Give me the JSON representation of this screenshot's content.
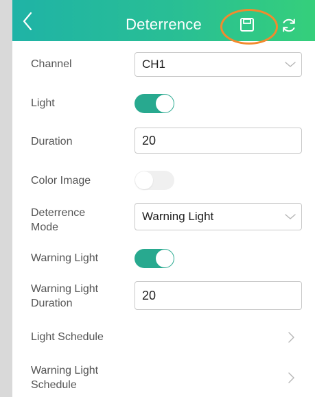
{
  "header": {
    "title": "Deterrence",
    "back_icon": "chevron-left-icon",
    "save_icon": "save-floppy-icon",
    "refresh_icon": "refresh-icon",
    "highlight_color": "#f28a2e",
    "gradient_colors": [
      "#1fb3a6",
      "#35cf7b"
    ]
  },
  "settings": {
    "channel": {
      "label": "Channel",
      "value": "CH1"
    },
    "light": {
      "label": "Light",
      "enabled": true
    },
    "duration": {
      "label": "Duration",
      "value": "20"
    },
    "color_image": {
      "label": "Color Image",
      "enabled": false
    },
    "deterrence_mode": {
      "label_line1": "Deterrence",
      "label_line2": "Mode",
      "value": "Warning Light"
    },
    "warning_light": {
      "label": "Warning Light",
      "enabled": true
    },
    "warning_light_duration": {
      "label_line1": "Warning Light",
      "label_line2": "Duration",
      "value": "20"
    },
    "light_schedule": {
      "label": "Light Schedule"
    },
    "warning_light_schedule": {
      "label_line1": "Warning Light",
      "label_line2": "Schedule"
    }
  },
  "colors": {
    "toggle_on": "#28a98f",
    "toggle_off": "#f0f0f0"
  }
}
